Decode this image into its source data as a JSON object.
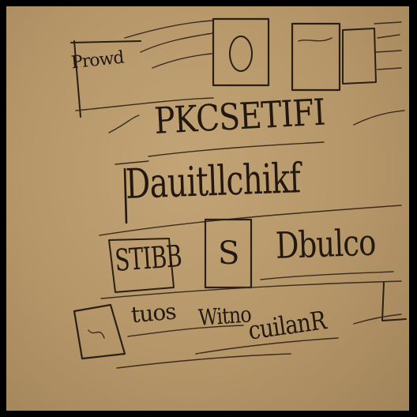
{
  "sketch": {
    "scribbles": [
      {
        "id": "corner-word",
        "text": "Prowd"
      },
      {
        "id": "heading",
        "text": "PKCSETIFI"
      },
      {
        "id": "main-line",
        "text": "Dauitllchikf"
      },
      {
        "id": "box-letter",
        "text": "S"
      },
      {
        "id": "left-word",
        "text": "STIBB"
      },
      {
        "id": "right-word",
        "text": "Dbulco"
      },
      {
        "id": "small-word-1",
        "text": "tuos"
      },
      {
        "id": "small-word-2",
        "text": "Witno"
      },
      {
        "id": "bottom-word",
        "text": "cuilanR"
      }
    ]
  },
  "colors": {
    "paper": "#b59669",
    "ink": "#2a1f14",
    "border": "#000000"
  }
}
